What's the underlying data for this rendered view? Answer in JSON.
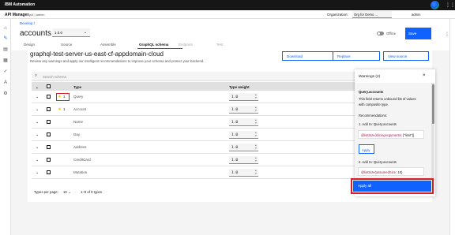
{
  "topbar": {
    "brand": "IBM Automation"
  },
  "subbar": {
    "product": "API Manager",
    "breadcrumb": "cp4i | admin",
    "org_label": "Organization:",
    "org_value": "Org for Demo ...",
    "user": "admin"
  },
  "header": {
    "breadcrumb": "Develop /",
    "title": "accounts",
    "version": "1.0.0",
    "toggle_label": "Offline",
    "save_label": "Save"
  },
  "tabs": [
    {
      "label": "Design",
      "state": "normal"
    },
    {
      "label": "Source",
      "state": "normal"
    },
    {
      "label": "Assemble",
      "state": "normal"
    },
    {
      "label": "GraphQL schema",
      "state": "active"
    },
    {
      "label": "Endpoint",
      "state": "disabled"
    },
    {
      "label": "Test",
      "state": "disabled"
    }
  ],
  "content": {
    "heading": "graphql-test-server-us-east-cf-appdomain-cloud",
    "description": "Review any warnings and apply our intelligent recommendations to improve your schema and protect your backend.",
    "buttons": {
      "download": "Download",
      "replace": "Replace",
      "view_source": "View source"
    },
    "search_placeholder": "Search schema",
    "table": {
      "col_type": "Type",
      "col_weight": "Type weight",
      "rows": [
        {
          "name": "Query",
          "warnings": "1",
          "weight": "1.0"
        },
        {
          "name": "Account",
          "warnings": "1",
          "weight": "1.0"
        },
        {
          "name": "Name",
          "warnings": "",
          "weight": "1.0"
        },
        {
          "name": "Day",
          "warnings": "",
          "weight": "1.0"
        },
        {
          "name": "Address",
          "warnings": "",
          "weight": "1.0"
        },
        {
          "name": "CreditCard",
          "warnings": "",
          "weight": "1.0"
        },
        {
          "name": "Mutation",
          "warnings": "",
          "weight": "1.0"
        }
      ]
    },
    "pager": {
      "label": "Types per page:",
      "per_page": "10",
      "range": "1–9 of 9 types"
    }
  },
  "warnings_panel": {
    "title": "Warnings (2)",
    "item1_title": "Query.accounts",
    "item1_desc_line1": "This field returns unbound list of values",
    "item1_desc_line2": "with composite type.",
    "recommendations_label": "Recommendations:",
    "rec1_label": "1. Add to: Query.accounts",
    "rec1_code_kw": "@listSize(slicingArguments:",
    "rec1_code_rest": " [\"limit\"])",
    "apply_label": "Apply",
    "rec2_label": "2. Add to: Query.accounts",
    "rec2_code_kw": "@listSize(assumedSize:",
    "rec2_code_rest": " 10)",
    "apply_all_label": "Apply all"
  },
  "colors": {
    "primary": "#0f62fe",
    "highlight": "#da1e28",
    "warning": "#f1c21b",
    "topbar": "#161616"
  }
}
